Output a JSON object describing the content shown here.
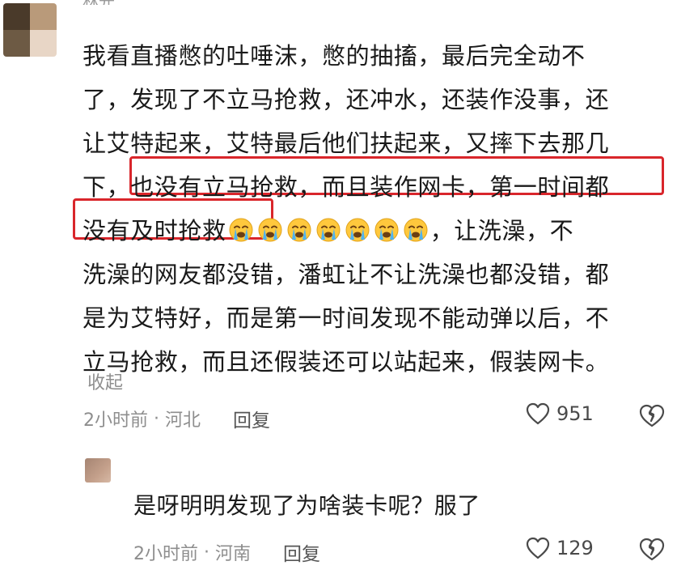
{
  "comment": {
    "username": "林光",
    "lines": [
      "我看直播憋的吐唾沫，憋的抽搐，最后完全动不",
      "了，发现了不立马抢救，还冲水，还装作没事，还",
      "让艾特起来，艾特最后他们扶起来，又摔下去那几",
      "下，也没有立马抢救，而且装作网卡，第一时间都",
      "没有及时抢救",
      "，让洗澡，不",
      "洗澡的网友都没错，潘虹让不让洗澡也都没错，都",
      "是为艾特好，而是第一时间发现不能动弹以后，不",
      "立马抢救，而且还假装还可以站起来，假装网卡。"
    ],
    "collapse_label": "收起",
    "time": "2小时前",
    "location": "河北",
    "reply_label": "回复",
    "like_count": "951"
  },
  "reply": {
    "text": "是呀明明发现了为啥装卡呢？服了",
    "time": "2小时前",
    "location": "河南",
    "reply_label": "回复",
    "like_count": "129"
  },
  "emoji": {
    "name": "crying-face-icon",
    "count": 7
  },
  "colors": {
    "highlight": "#d9262b",
    "meta": "#8e8e8e",
    "text": "#1a1a1a"
  }
}
